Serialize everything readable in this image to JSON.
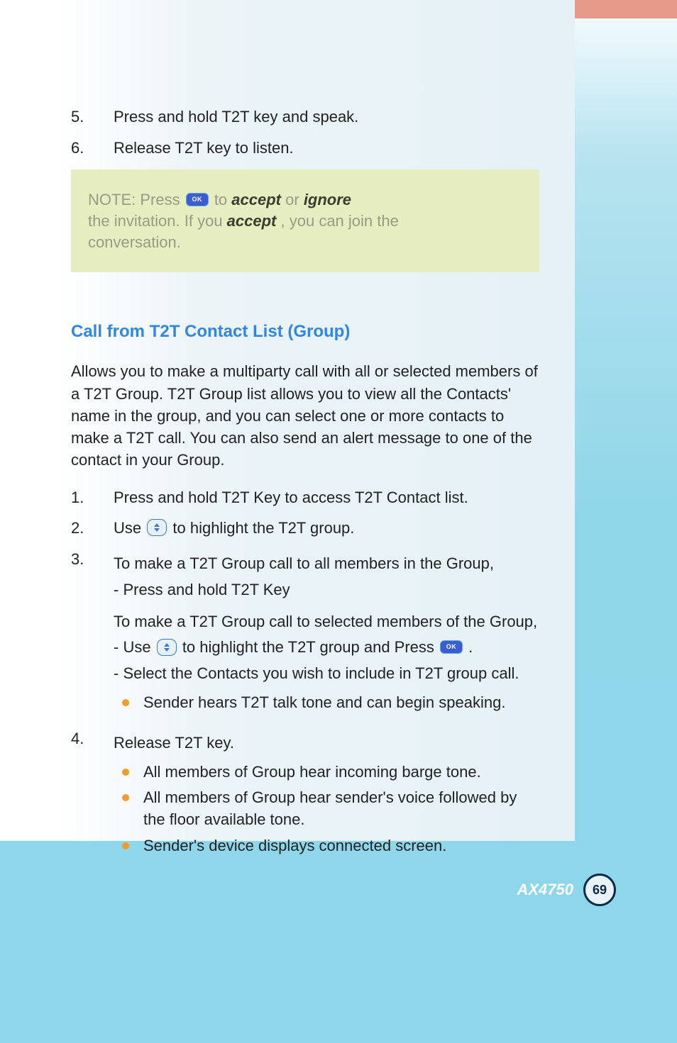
{
  "top_steps": [
    {
      "num": "5.",
      "text": "Press and hold T2T key and speak."
    },
    {
      "num": "6.",
      "text": "Release T2T key to listen."
    }
  ],
  "note": {
    "line1_prefix": "NOTE: Press ",
    "ok": "OK",
    "line1_mid": " to ",
    "accept1": "accept",
    "line1_or": " or ",
    "ignore": "ignore",
    "line2_prefix": "the invitation. If you ",
    "accept2": "accept",
    "line2_suffix": ", you can join the",
    "line3": "conversation."
  },
  "heading": "Call from T2T Contact List (Group)",
  "intro": "Allows you to make a multiparty call with all or selected members of a T2T Group. T2T Group list allows you to view all the Contacts' name in the group, and you can select one or more contacts to make a T2T call. You can also send an alert message to one of the contact in your Group.",
  "steps": {
    "s1": {
      "num": "1.",
      "text": "Press and hold T2T Key to access T2T Contact list."
    },
    "s2": {
      "num": "2.",
      "pre": "Use ",
      "post": " to highlight the T2T group."
    },
    "s3": {
      "num": "3.",
      "line1": "To make a T2T Group call to all members in the Group,",
      "line2": "- Press and hold T2T Key",
      "line3": "To make a T2T Group call to selected members of the Group,",
      "line4_pre": " - Use ",
      "line4_mid": " to highlight the T2T group and Press ",
      "line4_end": ".",
      "line5": " - Select the Contacts you wish to include in T2T group call.",
      "bullet1": "Sender hears T2T talk tone and can begin speaking."
    },
    "s4": {
      "num": "4.",
      "text": "Release T2T key.",
      "bullets": [
        "All members of Group hear incoming barge tone.",
        "All members of Group hear sender's voice followed by the floor available tone.",
        "Sender's device displays connected screen."
      ]
    }
  },
  "footer": {
    "model": "AX4750",
    "page": "69"
  }
}
